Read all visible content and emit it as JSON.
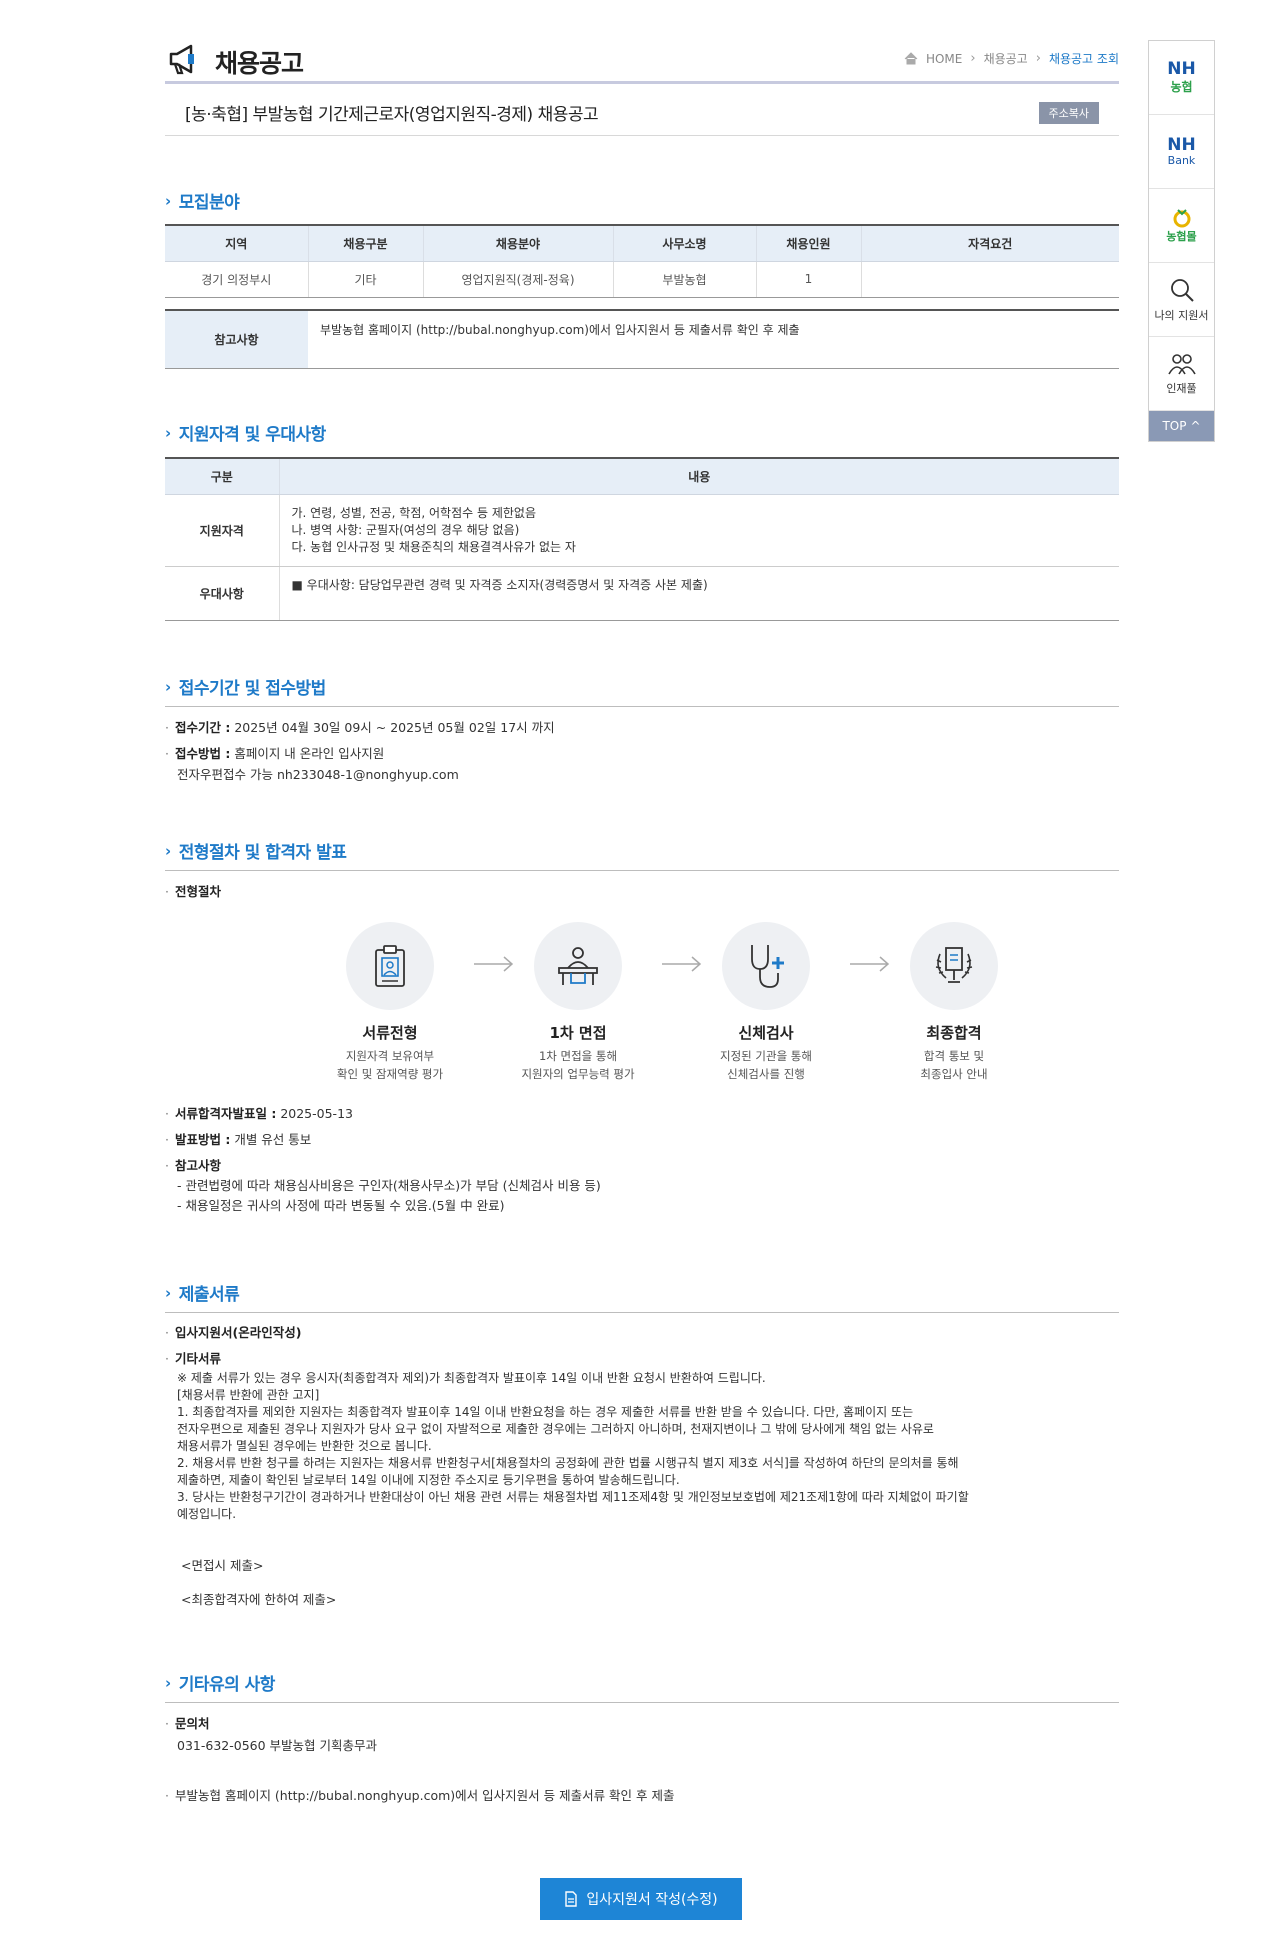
{
  "header": {
    "page_title": "채용공고",
    "breadcrumb": [
      "HOME",
      "채용공고",
      "채용공고 조회"
    ]
  },
  "job": {
    "title": "[농·축협] 부발농협 기간제근로자(영업지원직-경제) 채용공고",
    "copy_label": "주소복사"
  },
  "sections": {
    "recruit": "모집분야",
    "qualify": "지원자격 및 우대사항",
    "period": "접수기간 및 접수방법",
    "process": "전형절차 및 합격자 발표",
    "docs": "제출서류",
    "etc": "기타유의 사항"
  },
  "recruit_table": {
    "headers": [
      "지역",
      "채용구분",
      "채용분야",
      "사무소명",
      "채용인원",
      "자격요건"
    ],
    "row": [
      "경기 의정부시",
      "기타",
      "영업지원직(경제-정육)",
      "부발농협",
      "1",
      ""
    ]
  },
  "note": {
    "label": "참고사항",
    "text": "부발농협 홈페이지 (http://bubal.nonghyup.com)에서 입사지원서 등 제출서류 확인 후 제출"
  },
  "qualify_table": {
    "headers": [
      "구분",
      "내용"
    ],
    "qualify_label": "지원자격",
    "qualify_lines": [
      "가. 연령, 성별, 전공, 학점, 어학점수 등 제한없음",
      "나. 병역 사항: 군필자(여성의 경우 해당 없음)",
      "다. 농협 인사규정 및 채용준칙의 채용결격사유가 없는 자"
    ],
    "prefer_label": "우대사항",
    "prefer_text": "■ 우대사항: 담당업무관련 경력 및 자격증 소지자(경력증명서 및 자격증 사본 제출)"
  },
  "period": {
    "period_label": "접수기간 :",
    "period_value": "2025년 04월 30일 09시 ~ 2025년 05월 02일 17시 까지",
    "method_label": "접수방법 :",
    "method_value": "홈페이지 내 온라인 입사지원",
    "method_extra": "전자우편접수 가능 nh233048-1@nonghyup.com"
  },
  "process": {
    "label": "전형절차",
    "steps": [
      {
        "name": "서류전형",
        "desc1": "지원자격 보유여부",
        "desc2": "확인 및 잠재역량 평가"
      },
      {
        "name": "1차 면접",
        "desc1": "1차 면접을 통해",
        "desc2": "지원자의 업무능력 평가"
      },
      {
        "name": "신체검사",
        "desc1": "지정된 기관을 통해",
        "desc2": "신체검사를 진행"
      },
      {
        "name": "최종합격",
        "desc1": "합격 통보 및",
        "desc2": "최종입사 안내"
      }
    ],
    "announce_label": "서류합격자발표일 :",
    "announce_value": "2025-05-13",
    "notify_label": "발표방법 :",
    "notify_value": "개별 유선 통보",
    "ref_label": "참고사항",
    "ref_lines": [
      "- 관련법령에 따라 채용심사비용은 구인자(채용사무소)가 부담 (신체검사 비용 등)",
      "- 채용일정은 귀사의 사정에 따라 변동될 수 있음.(5월 中 완료)"
    ]
  },
  "docs": {
    "item1": "입사지원서(온라인작성)",
    "item2": "기타서류",
    "body": [
      "※ 제출 서류가 있는 경우 응시자(최종합격자 제외)가 최종합격자 발표이후 14일 이내 반환 요청시 반환하여 드립니다.",
      "[채용서류 반환에 관한 고지]",
      " 1. 최종합격자를 제외한 지원자는 최종합격자 발표이후 14일 이내 반환요청을 하는 경우 제출한 서류를 반환 받을 수 있습니다. 다만, 홈페이지 또는",
      "전자우편으로 제출된 경우나 지원자가 당사 요구 없이 자발적으로 제출한 경우에는 그러하지 아니하며, 천재지변이나 그 밖에 당사에게 책임 없는 사유로",
      "채용서류가 멸실된 경우에는 반환한 것으로 봅니다.",
      " 2. 채용서류 반환 청구를 하려는 지원자는 채용서류 반환청구서[채용절차의 공정화에 관한 법률 시행규칙 별지 제3호 서식]를 작성하여 하단의 문의처를 통해",
      "제출하면, 제출이 확인된 날로부터 14일 이내에 지정한 주소지로 등기우편을 통하여 발송해드립니다.",
      " 3. 당사는 반환청구기간이 경과하거나 반환대상이 아닌 채용 관련 서류는 채용절차법 제11조제4항 및 개인정보보호법에 제21조제1항에 따라 지체없이 파기할",
      "예정입니다."
    ],
    "interview": "<면접시 제출>",
    "final": "<최종합격자에 한하여 제출>"
  },
  "etc": {
    "contact_label": "문의처",
    "contact_value": "031-632-0560 부발농협 기획총무과",
    "note": "부발농협 홈페이지 (http://bubal.nonghyup.com)에서 입사지원서 등 제출서류 확인 후 제출"
  },
  "apply_button": "입사지원서 작성(수정)",
  "quick_menu": {
    "nh1_top": "NH",
    "nh1_bottom": "농협",
    "nh2_top": "NH",
    "nh2_bottom": "Bank",
    "mall": "농협몰",
    "my_apply": "나의 지원서",
    "talent": "인재풀",
    "top": "TOP"
  },
  "colors": {
    "accent": "#1e7ac8",
    "header_bg": "#e6eef7",
    "button": "#1e85d6",
    "nh_green": "#2ca04b",
    "nh_blue": "#1a58a8"
  }
}
